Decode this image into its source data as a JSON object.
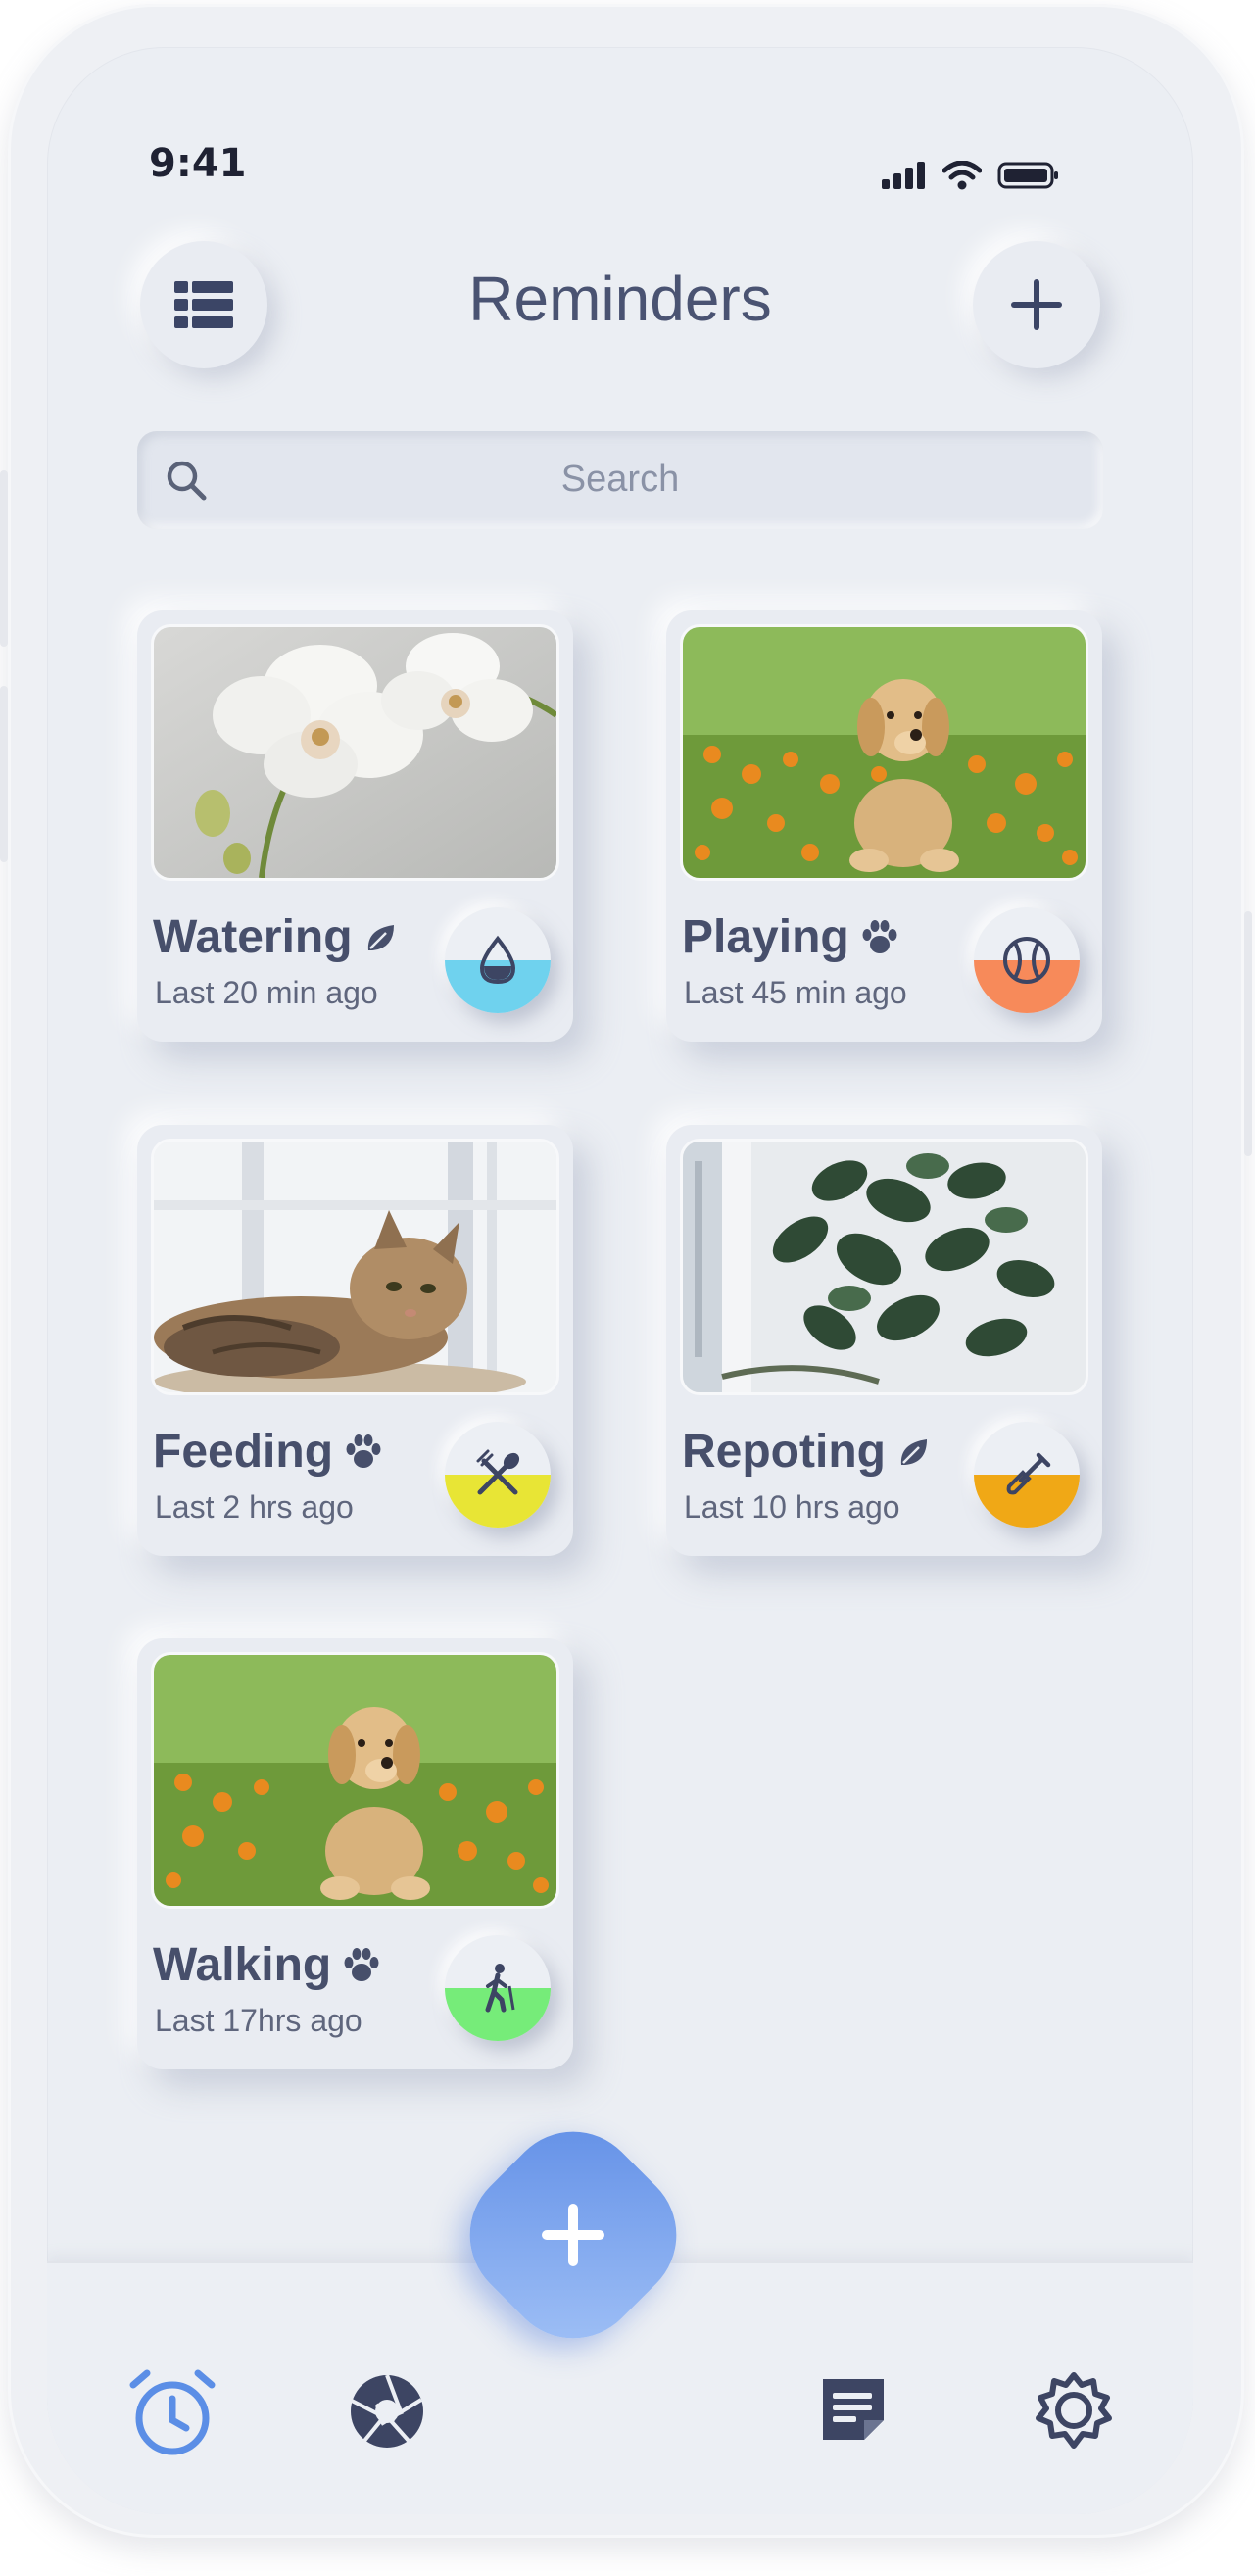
{
  "status": {
    "time": "9:41"
  },
  "header": {
    "title": "Reminders"
  },
  "search": {
    "placeholder": "Search"
  },
  "cards": [
    {
      "title": "Watering",
      "category_icon": "leaf-icon",
      "subtitle": "Last 20 min ago",
      "action_icon": "water-drop-icon",
      "action_color": "#6fd2ee"
    },
    {
      "title": "Playing",
      "category_icon": "paw-icon",
      "subtitle": "Last 45 min ago",
      "action_icon": "ball-icon",
      "action_color": "#f78a5a"
    },
    {
      "title": "Feeding",
      "category_icon": "paw-icon",
      "subtitle": "Last 2 hrs ago",
      "action_icon": "utensils-icon",
      "action_color": "#e8e535"
    },
    {
      "title": "Repoting",
      "category_icon": "leaf-icon",
      "subtitle": "Last 10 hrs ago",
      "action_icon": "shovel-icon",
      "action_color": "#f0a816"
    },
    {
      "title": "Walking",
      "category_icon": "paw-icon",
      "subtitle": "Last 17hrs ago",
      "action_icon": "walking-person-icon",
      "action_color": "#76ec79"
    }
  ],
  "tabbar": {
    "items": [
      "alarm-clock-icon",
      "aperture-icon",
      "add-icon",
      "notes-icon",
      "settings-icon"
    ],
    "active": "alarm-clock-icon",
    "accent": "#5b8ee6"
  }
}
